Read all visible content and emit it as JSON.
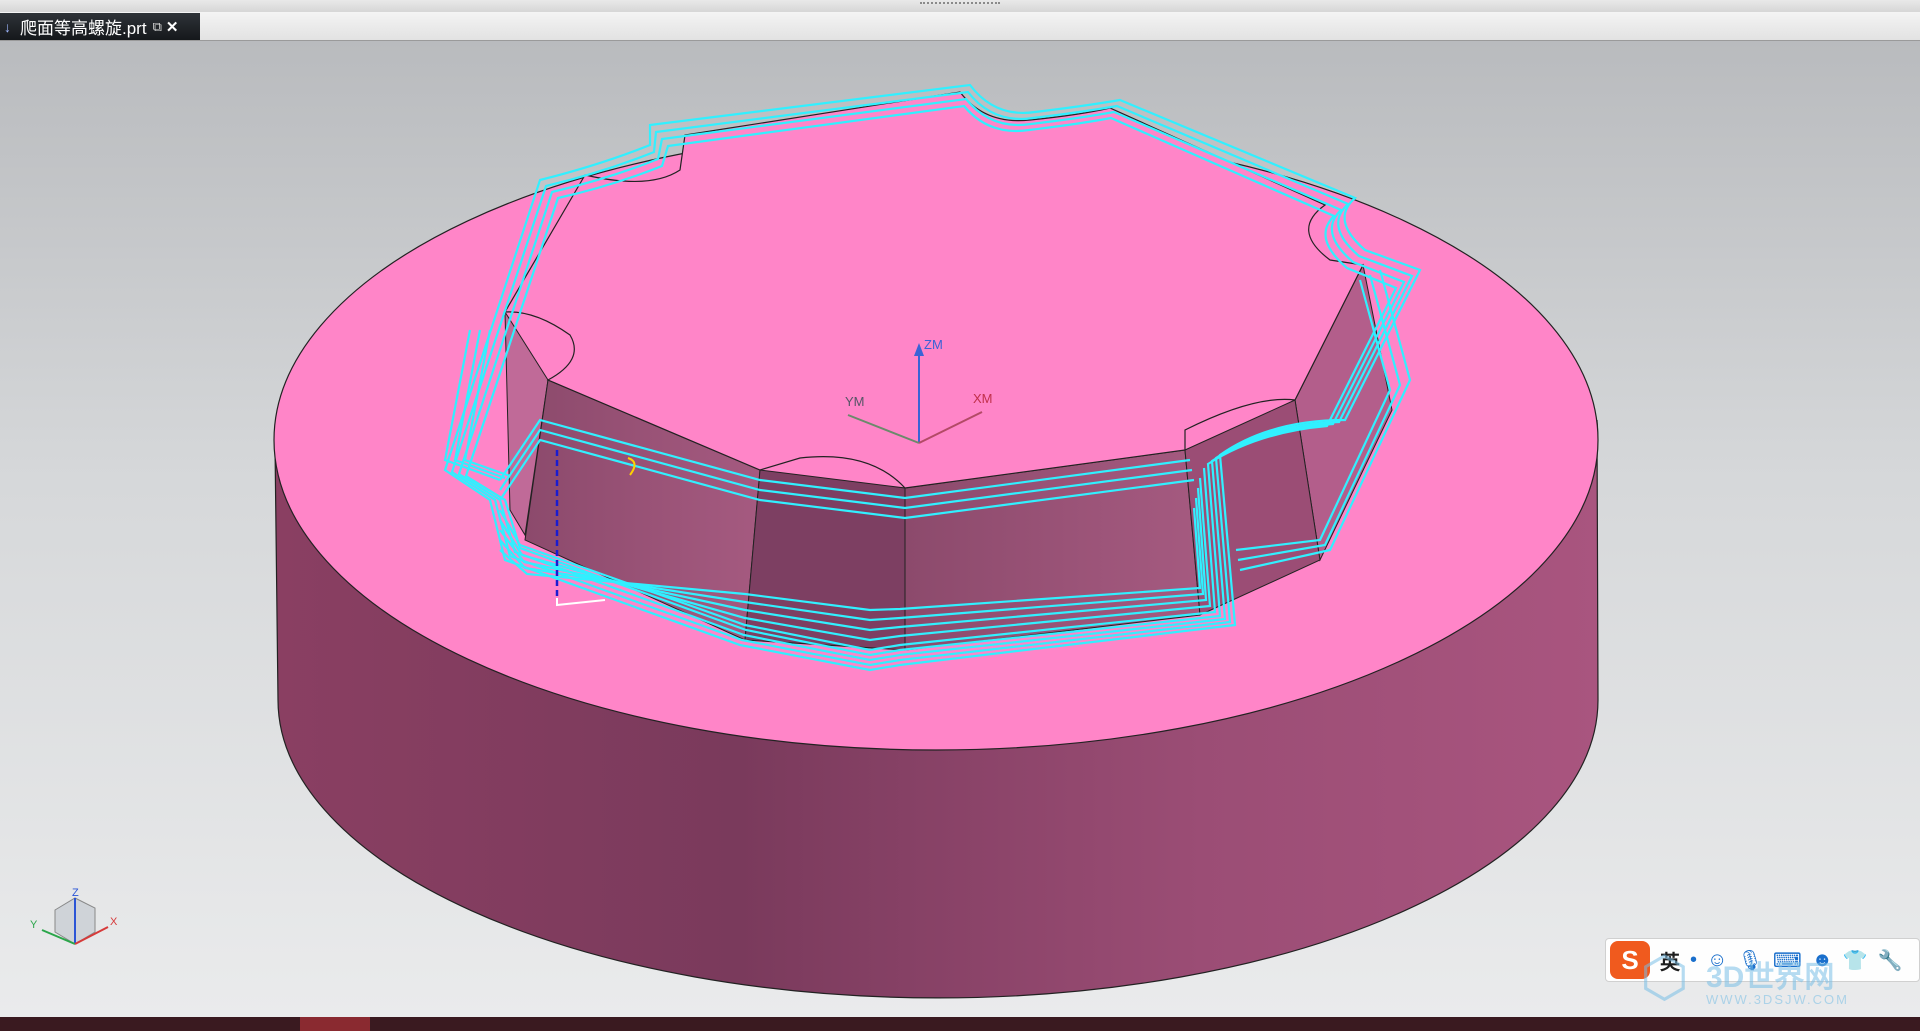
{
  "tab": {
    "title": "爬面等高螺旋.prt",
    "pin_icon": "pin-icon",
    "undock_icon": "undock-icon",
    "close_icon": "close-icon"
  },
  "viewport": {
    "wcs": {
      "z_label": "ZM",
      "y_label": "YM",
      "x_label": "XM"
    },
    "triad": {
      "z_label": "Z",
      "y_label": "Y",
      "x_label": "X"
    }
  },
  "colors": {
    "top_face": "#ff85c8",
    "side_face": "#9c4c74",
    "toolpath": "#31f0ff",
    "background_top": "#b9bbbe",
    "background_bottom": "#eaebec"
  },
  "ime": {
    "logo": "S",
    "lang": "英",
    "tools": [
      "dot-icon",
      "emoji-icon",
      "mic-icon",
      "keyboard-icon",
      "user-icon",
      "shirt-icon",
      "wrench-icon"
    ]
  },
  "watermark": {
    "brand": "3D世界网",
    "url": "WWW.3DSJW.COM"
  }
}
